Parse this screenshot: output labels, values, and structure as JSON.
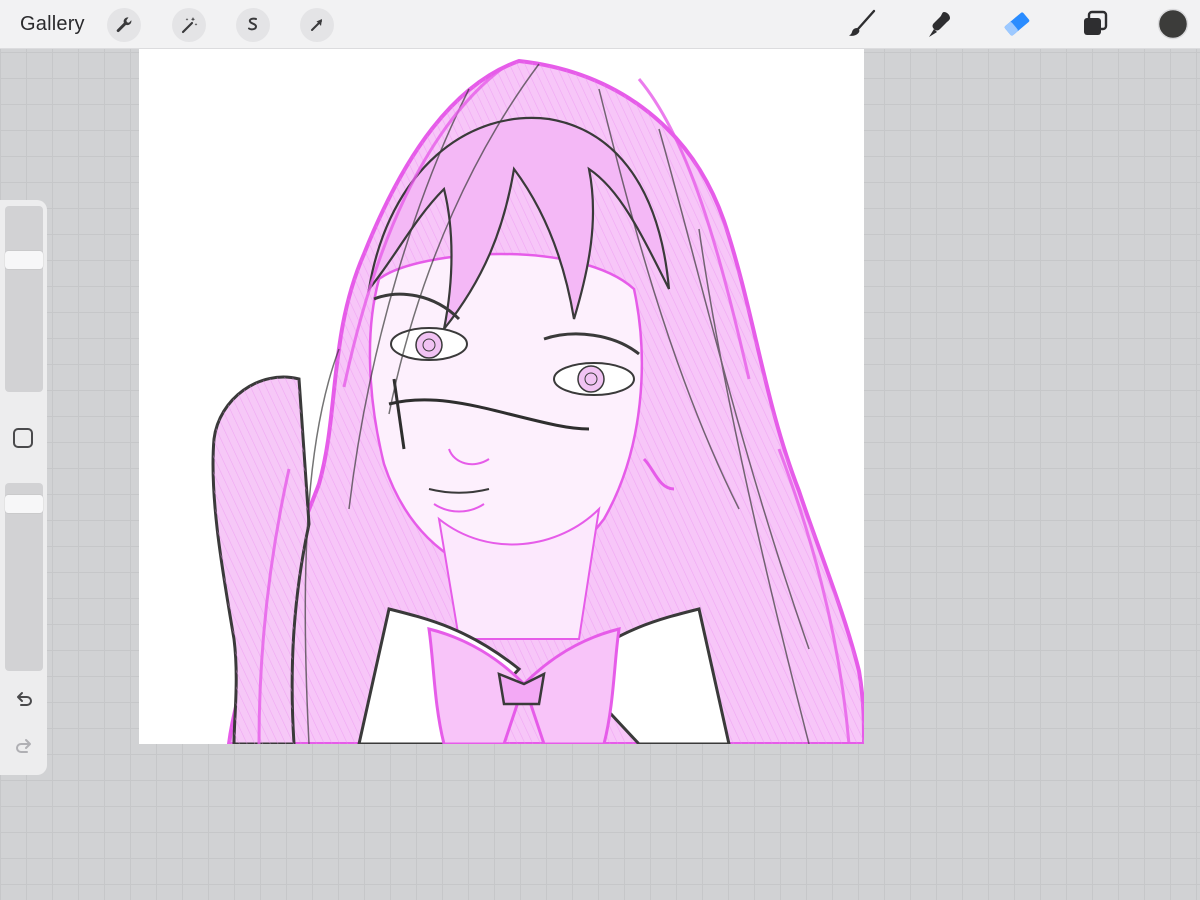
{
  "app": {
    "gallery_label": "Gallery"
  },
  "toolbar": {
    "left_tools": [
      {
        "icon": "wrench-icon",
        "name": "actions"
      },
      {
        "icon": "magic-wand-icon",
        "name": "adjustments"
      },
      {
        "icon": "selection-icon",
        "name": "selection"
      },
      {
        "icon": "arrow-cursor-icon",
        "name": "transform"
      }
    ],
    "right_tools": [
      {
        "icon": "brush-icon",
        "name": "paint"
      },
      {
        "icon": "smudge-icon",
        "name": "smudge"
      },
      {
        "icon": "eraser-icon",
        "name": "erase",
        "active": true
      },
      {
        "icon": "layers-icon",
        "name": "layers"
      },
      {
        "icon": "color-swatch-icon",
        "name": "color"
      }
    ],
    "active_tool_color": "#2a8cff",
    "current_color": "#3c3c3a"
  },
  "sidebar": {
    "brush_size_level": 0.73,
    "opacity_level": 0.07,
    "undo_icon": "undo-icon",
    "redo_icon": "redo-icon"
  },
  "canvas": {
    "background": "#ffffff",
    "sketch_color": "#e65ce9",
    "line_color": "#3a3a3a"
  }
}
